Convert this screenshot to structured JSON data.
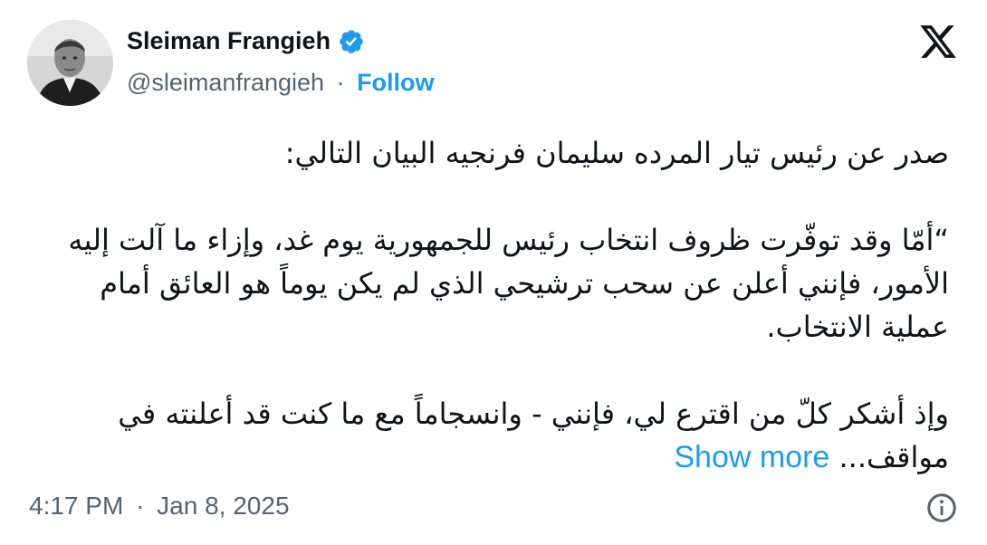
{
  "author": {
    "name": "Sleiman Frangieh",
    "handle": "@sleimanfrangieh",
    "separator": "·",
    "follow_label": "Follow"
  },
  "icons": {
    "verified": "verified-badge-icon",
    "brand": "x-logo-icon",
    "info": "info-icon"
  },
  "colors": {
    "accent": "#1d9bf0",
    "text": "#0f1419",
    "secondary": "#536471"
  },
  "tweet": {
    "paragraphs": [
      "صدر عن رئيس تيار المرده سليمان فرنجيه البيان التالي:",
      "“أمّا وقد توفّرت ظروف انتخاب رئيس للجمهورية يوم غد، وإزاء ما آلت إليه الأمور، فإنني أعلن عن سحب ترشيحي الذي لم يكن يوماً هو العائق أمام عملية الانتخاب.",
      "وإذ أشكر كلّ من اقترع لي، فإنني - وانسجاماً مع ما كنت قد أعلنته في مواقف..."
    ],
    "show_more_label": "Show more"
  },
  "meta": {
    "time": "4:17 PM",
    "separator": "·",
    "date": "Jan 8, 2025"
  }
}
